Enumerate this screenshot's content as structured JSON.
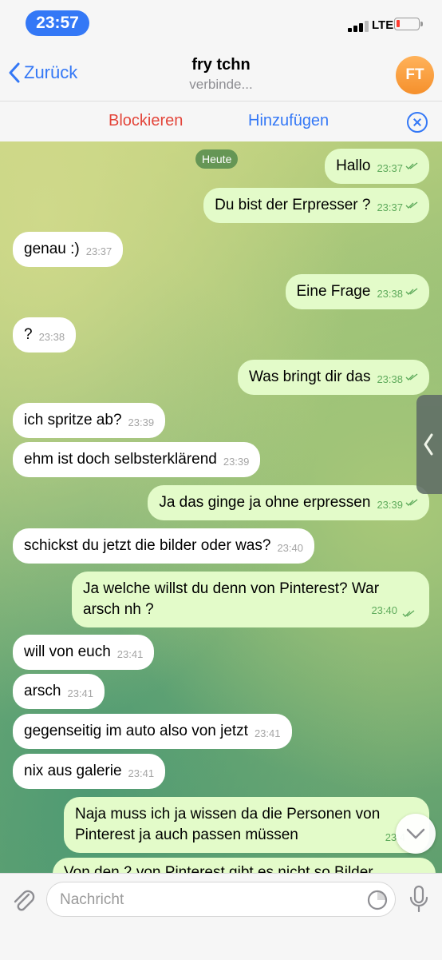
{
  "status_bar": {
    "time": "23:57",
    "network": "LTE"
  },
  "header": {
    "back_label": "Zurück",
    "title": "fry tchn",
    "subtitle": "verbinde...",
    "avatar_initials": "FT"
  },
  "action_bar": {
    "block_label": "Blockieren",
    "add_label": "Hinzufügen"
  },
  "chat": {
    "date_label": "Heute",
    "messages": [
      {
        "dir": "out",
        "text": "Hallo",
        "time": "23:37"
      },
      {
        "dir": "out",
        "text": "Du bist der Erpresser ?",
        "time": "23:37"
      },
      {
        "dir": "in",
        "text": "genau :)",
        "time": "23:37"
      },
      {
        "dir": "out",
        "text": "Eine Frage",
        "time": "23:38"
      },
      {
        "dir": "in",
        "text": "?",
        "time": "23:38"
      },
      {
        "dir": "out",
        "text": "Was bringt dir das",
        "time": "23:38"
      },
      {
        "dir": "in",
        "text": "ich spritze ab?",
        "time": "23:39"
      },
      {
        "dir": "in",
        "text": "ehm ist doch selbsterklärend",
        "time": "23:39"
      },
      {
        "dir": "out",
        "text": "Ja das ginge ja ohne erpressen",
        "time": "23:39"
      },
      {
        "dir": "in",
        "text": "schickst du jetzt die bilder oder was?",
        "time": "23:40"
      },
      {
        "dir": "out",
        "text": "Ja welche willst du denn von Pinterest? War arsch nh ?",
        "time": "23:40"
      },
      {
        "dir": "in",
        "text": "will von euch",
        "time": "23:41"
      },
      {
        "dir": "in",
        "text": "arsch",
        "time": "23:41"
      },
      {
        "dir": "in",
        "text": "gegenseitig im auto also von jetzt",
        "time": "23:41"
      },
      {
        "dir": "in",
        "text": "nix aus galerie",
        "time": "23:41"
      },
      {
        "dir": "out",
        "text": "Naja muss ich ja wissen da die Personen von Pinterest ja auch passen müssen",
        "time": "23:4"
      },
      {
        "dir": "out",
        "text": "Von den 2 von Pinterest gibt es nicht so Bilder",
        "time": ""
      }
    ]
  },
  "input": {
    "placeholder": "Nachricht"
  },
  "colors": {
    "accent": "#3478f6",
    "danger": "#e3453a",
    "outgoing_bubble": "#e3fbc9",
    "incoming_bubble": "#ffffff"
  },
  "icons": [
    "back-chevron-icon",
    "close-icon",
    "attach-icon",
    "sticker-icon",
    "microphone-icon",
    "chevron-down-icon",
    "sidebar-chevron-icon"
  ]
}
